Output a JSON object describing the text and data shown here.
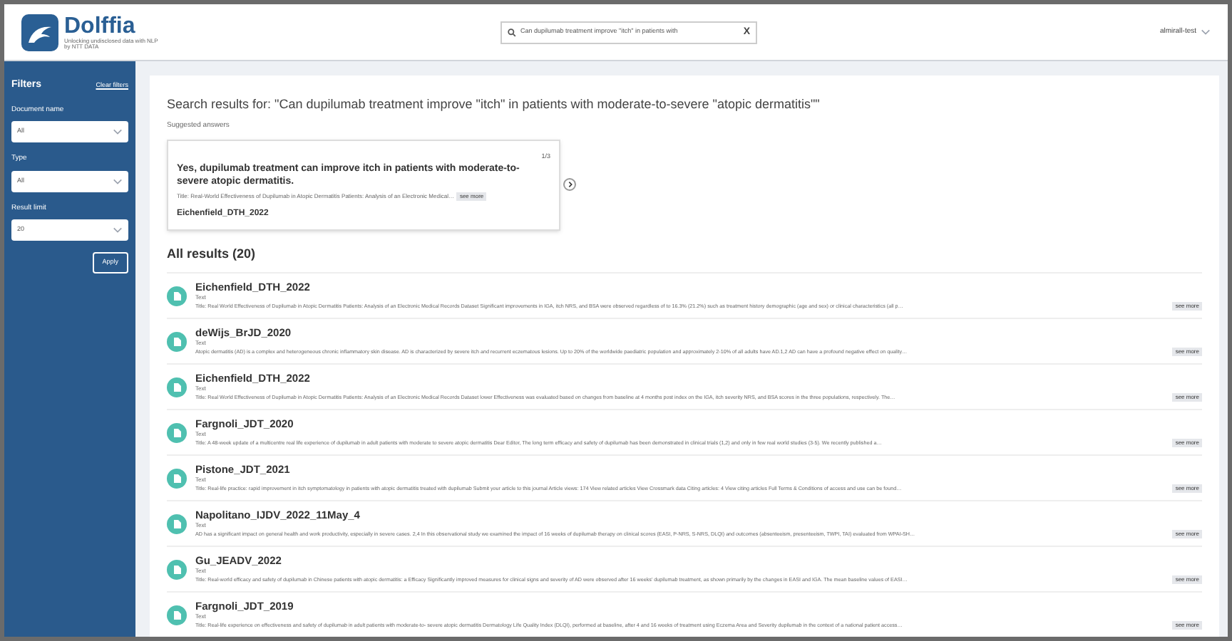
{
  "header": {
    "logo_title": "Dolffia",
    "logo_subtitle": "Unlocking undisclosed data with NLP",
    "logo_byline": "by NTT DATA",
    "search": {
      "value": "Can dupilumab treatment improve \"itch\" in patients with",
      "clear": "X"
    },
    "user": "almirall-test"
  },
  "filters": {
    "title": "Filters",
    "clear": "Clear filters",
    "fields": [
      {
        "label": "Document name",
        "value": "All"
      },
      {
        "label": "Type",
        "value": "All"
      },
      {
        "label": "Result limit",
        "value": "20"
      }
    ],
    "apply": "Apply"
  },
  "search_heading": "Search results for: \"Can dupilumab treatment improve \"itch\" in patients with moderate-to-severe \"atopic dermatitis\"\"",
  "suggested": {
    "label": "Suggested answers",
    "counter": "1/3",
    "answer": "Yes, dupilumab treatment can improve itch in patients with moderate-to-severe atopic dermatitis.",
    "snippet": "Title: Real-World Effectiveness of Dupilumab in Atopic Dermatitis Patients: Analysis of an Electronic Medical…",
    "more": "see more",
    "source": "Eichenfield_DTH_2022"
  },
  "results_heading": "All results (20)",
  "results": [
    {
      "name": "Eichenfield_DTH_2022",
      "type": "Text",
      "snippet": "Title: Real World Effectiveness of Dupilumab in Atopic Dermatitis Patients: Analysis of an Electronic Medical Records Dataset Significant improvements in IGA, itch NRS, and BSA were observed regardless of to 16.3% (21.2%) such as treatment history demographic (age and sex) or clinical characteristics (all p…",
      "more": "see more"
    },
    {
      "name": "deWijs_BrJD_2020",
      "type": "Text",
      "snippet": "Atopic dermatitis (AD) is a complex and heterogeneous chronic inflammatory skin disease. AD is characterized by severe itch and recurrent eczematous lesions. Up to 20% of the worldwide paediatric population and approximately 2-10% of all adults have AD.1,2 AD can have a profound negative effect on quality…",
      "more": "see more"
    },
    {
      "name": "Eichenfield_DTH_2022",
      "type": "Text",
      "snippet": "Title: Real World Effectiveness of Dupilumab in Atopic Dermatitis Patients: Analysis of an Electronic Medical Records Dataset lower Effectiveness was evaluated based on changes from baseline at 4 months post index on the IGA, itch severity NRS, and BSA scores in the three populations, respectively. The…",
      "more": "see more"
    },
    {
      "name": "Fargnoli_JDT_2020",
      "type": "Text",
      "snippet": "Title: A 48-week update of a multicentre real life experience of dupilumab in adult patients with moderate to severe atopic dermatitis Dear Editor, The long term efficacy and safety of dupilumab has been demonstrated in clinical trials (1,2) and only in few real world studies (3-5). We recently published a…",
      "more": "see more"
    },
    {
      "name": "Pistone_JDT_2021",
      "type": "Text",
      "snippet": "Title: Real-life practice: rapid improvement in itch symptomatology in patients with atopic dermatitis treated with dupilumab Submit your article to this journal Article views: 174 View related articles View Crossmark data Citing articles: 4 View citing articles Full Terms & Conditions of access and use can be found…",
      "more": "see more"
    },
    {
      "name": "Napolitano_IJDV_2022_11May_4",
      "type": "Text",
      "snippet": "AD has a significant impact on general health and work productivity, especially in severe cases. 2,4 In this observational study we examined the impact of 16 weeks of dupilumab therapy on clinical scores (EASI, P-NRS, S-NRS, DLQI) and outcomes (absenteeism, presenteeism, TWPI, TAI) evaluated from WPAI-SH…",
      "more": "see more"
    },
    {
      "name": "Gu_JEADV_2022",
      "type": "Text",
      "snippet": "Title: Real-world efficacy and safety of dupilumab in Chinese patients with atopic dermatitis: a Efficacy Significantly improved measures for clinical signs and severity of AD were observed after 16 weeks' dupilumab treatment, as shown primarily by the changes in EASI and IGA. The mean baseline values of EASI…",
      "more": "see more"
    },
    {
      "name": "Fargnoli_JDT_2019",
      "type": "Text",
      "snippet": "Title: Real-life experience on effectiveness and safety of dupilumab in adult patients with moderate-to- severe atopic dermatitis Dermatology Life Quality Index (DLQI), performed at baseline, after 4 and 16 weeks of treatment using Eczema Area and Severity dupilumab in the context of a national patient access…",
      "more": "see more"
    }
  ]
}
